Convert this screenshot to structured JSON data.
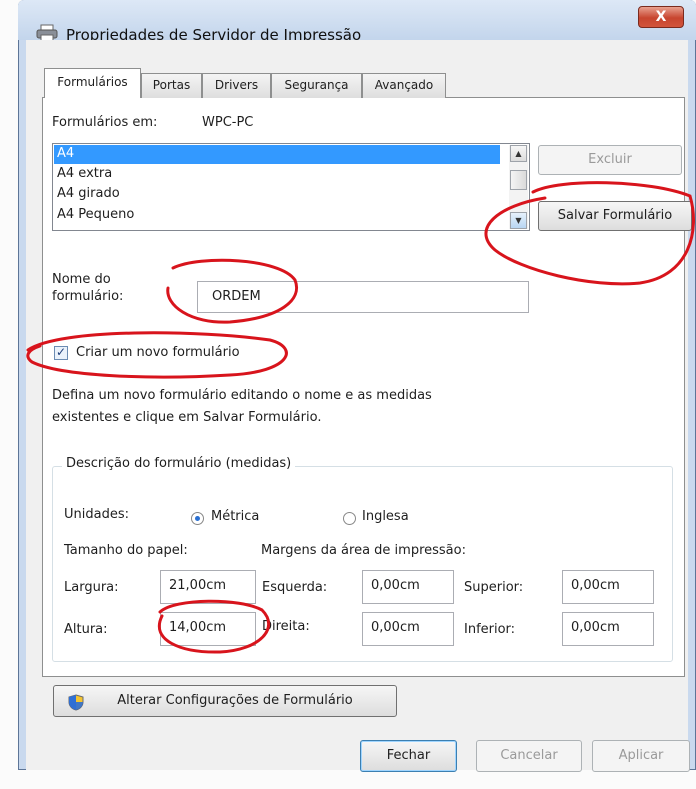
{
  "window": {
    "title": "Propriedades de Servidor de Impressão",
    "close_label": "X"
  },
  "tabs": [
    "Formulários",
    "Portas",
    "Drivers",
    "Segurança",
    "Avançado"
  ],
  "forms_on": {
    "label": "Formulários em:",
    "value": "WPC-PC"
  },
  "form_list": [
    "A4",
    "A4 extra",
    "A4 girado",
    "A4 Pequeno"
  ],
  "buttons": {
    "delete": "Excluir",
    "save_form": "Salvar Formulário",
    "change_settings": "Alterar Configurações de Formulário",
    "close": "Fechar",
    "cancel": "Cancelar",
    "apply": "Aplicar"
  },
  "form_name": {
    "label_line1": "Nome do",
    "label_line2": "formulário:",
    "value": "ORDEM"
  },
  "create_new": {
    "label": "Criar um novo formulário",
    "checked": true
  },
  "instructions": {
    "line1": "Defina um novo formulário editando o nome e as medidas",
    "line2": "existentes e clique em Salvar Formulário."
  },
  "description_group": {
    "title": "Descrição do formulário (medidas)",
    "units_label": "Unidades:",
    "metric": "Métrica",
    "imperial": "Inglesa",
    "selected_unit": "Métrica",
    "paper_size_label": "Tamanho do papel:",
    "margins_label": "Margens da área de impressão:",
    "width_label": "Largura:",
    "width_value": "21,00cm",
    "height_label": "Altura:",
    "height_value": "14,00cm",
    "left_label": "Esquerda:",
    "left_value": "0,00cm",
    "right_label": "Direita:",
    "right_value": "0,00cm",
    "top_label": "Superior:",
    "top_value": "0,00cm",
    "bottom_label": "Inferior:",
    "bottom_value": "0,00cm"
  },
  "colors": {
    "selection": "#3399ff",
    "annotation": "#d8141c"
  }
}
